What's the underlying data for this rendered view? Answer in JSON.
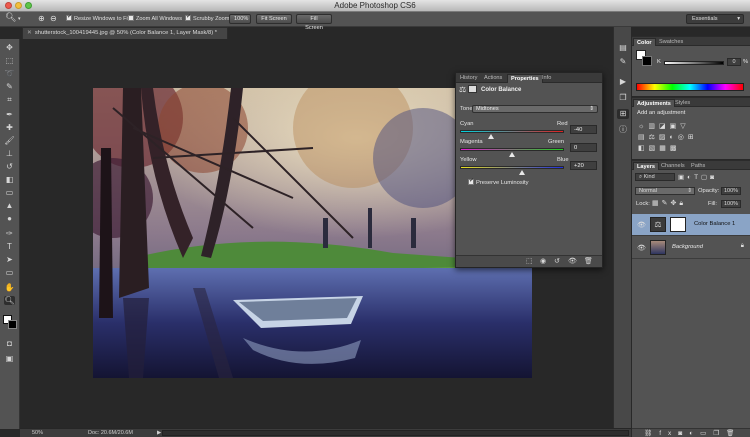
{
  "app": {
    "title": "Adobe Photoshop CS6"
  },
  "options_bar": {
    "resize_windows": "Resize Windows to Fit",
    "zoom_all": "Zoom All Windows",
    "scrubby_zoom": "Scrubby Zoom",
    "zoom_level_btn": "100%",
    "fit_screen": "Fit Screen",
    "fill_screen": "Fill Screen",
    "workspace": "Essentials"
  },
  "document": {
    "tab_title": "shutterstock_100419445.jpg @ 50% (Color Balance 1, Layer Mask/8) *"
  },
  "status": {
    "zoom": "50%",
    "doc": "Doc: 20.6M/20.6M"
  },
  "properties_panel": {
    "tabs": [
      "History",
      "Actions",
      "Properties",
      "Info"
    ],
    "active_tab": "Properties",
    "heading": "Color Balance",
    "tone_label": "Tone:",
    "tone_value": "Midtones",
    "sliders": [
      {
        "left": "Cyan",
        "right": "Red",
        "value": "-40",
        "percent": 0.3
      },
      {
        "left": "Magenta",
        "right": "Green",
        "value": "0",
        "percent": 0.5
      },
      {
        "left": "Yellow",
        "right": "Blue",
        "value": "+20",
        "percent": 0.6
      }
    ],
    "preserve_luminosity": "Preserve Luminosity"
  },
  "color_panel": {
    "tabs": [
      "Color",
      "Swatches"
    ],
    "slider_label": "K",
    "value": "0",
    "unit": "%"
  },
  "adjustments_panel": {
    "tabs": [
      "Adjustments",
      "Styles"
    ],
    "heading": "Add an adjustment"
  },
  "layers_panel": {
    "tabs": [
      "Layers",
      "Channels",
      "Paths"
    ],
    "kind_label": "Kind",
    "blend_mode": "Normal",
    "opacity_label": "Opacity:",
    "opacity_value": "100%",
    "lock_label": "Lock:",
    "fill_label": "Fill:",
    "fill_value": "100%",
    "layers": [
      {
        "name": "Color Balance 1",
        "selected": true
      },
      {
        "name": "Background",
        "selected": false
      }
    ]
  }
}
